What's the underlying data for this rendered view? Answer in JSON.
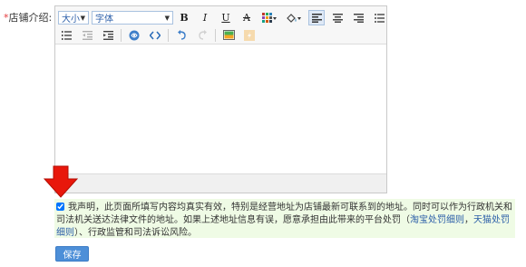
{
  "field": {
    "required_mark": "*",
    "label": "店铺介绍:"
  },
  "editor": {
    "size_select": "大小",
    "font_select": "字体",
    "toolbar_row1": [
      {
        "name": "bold-button",
        "glyph": "B"
      },
      {
        "name": "italic-button",
        "glyph": "I"
      },
      {
        "name": "underline-button",
        "glyph": "U"
      },
      {
        "name": "strikethrough-button",
        "glyph": "A"
      }
    ],
    "icons": [
      "table-icon",
      "paint-bucket-icon",
      "align-left-icon",
      "align-center-icon",
      "align-right-icon",
      "bullet-list-icon",
      "ordered-list-icon",
      "outdent-icon",
      "indent-icon",
      "link-icon",
      "code-icon",
      "undo-icon",
      "redo-icon",
      "image-icon",
      "flash-icon"
    ],
    "active_align": "align-left"
  },
  "declaration": {
    "checked": true,
    "text_before": "我声明，此页面所填写内容均真实有效，特别是经营地址为店铺最新可联系到的地址。同时可以作为行政机关和司法机关送达法律文件的地址。如果上述地址信息有误，愿意承担由此带来的平台处罚（",
    "link1": "淘宝处罚细则",
    "sep": "，",
    "link2": "天猫处罚细则",
    "text_after": "）、行政监管和司法诉讼风险。"
  },
  "save_button": "保存",
  "colors": {
    "accent": "#4d8fd8",
    "declaration_bg": "#effbe5",
    "required": "#e4393c",
    "arrow": "#e8170b"
  }
}
